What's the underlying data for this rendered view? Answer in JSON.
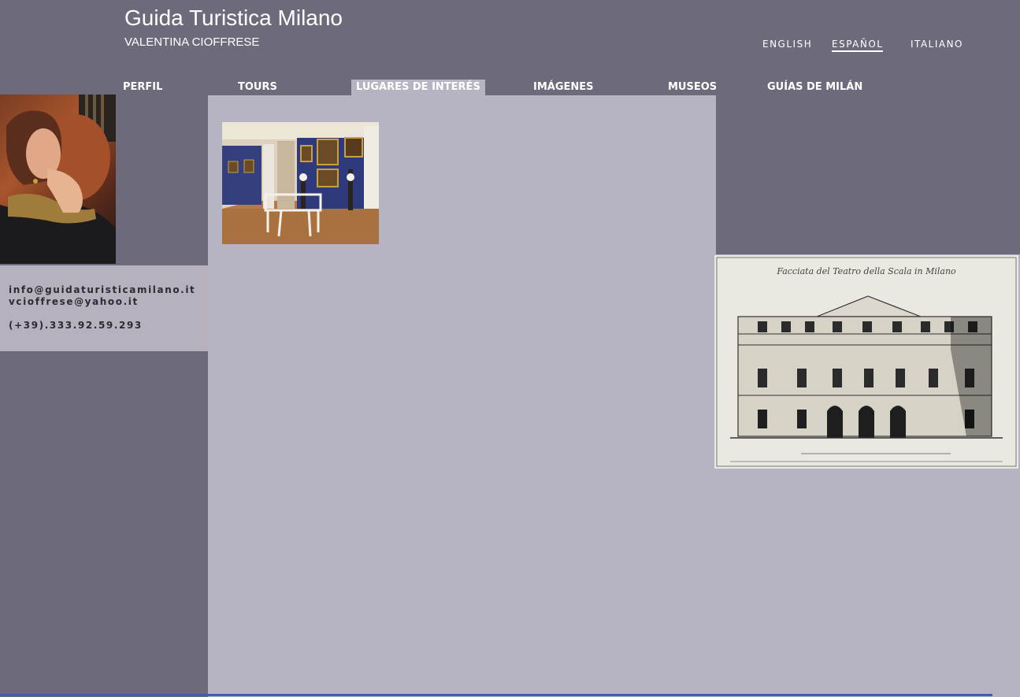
{
  "header": {
    "title": "Guida Turistica Milano",
    "subtitle": "VALENTINA CIOFFRESE"
  },
  "languages": [
    {
      "label": "ENGLISH",
      "active": false
    },
    {
      "label": "ESPAÑOL",
      "active": true
    },
    {
      "label": "ITALIANO",
      "active": false
    }
  ],
  "nav": [
    {
      "label": "PERFIL"
    },
    {
      "label": "TOURS"
    },
    {
      "label": "LUGARES DE INTERÉS",
      "active": true
    },
    {
      "label": "IMÁGENES"
    },
    {
      "label": "MUSEOS"
    },
    {
      "label": "GUÍAS DE MILÁN"
    }
  ],
  "contact": {
    "email1": "info@guidaturisticamilano.it",
    "email2": "vcioffrese@yahoo.it",
    "phone": "(+39).333.92.59.293"
  },
  "engraving": {
    "caption": "Facciata del Teatro della Scala in Milano"
  },
  "colors": {
    "background": "#6d6b7b",
    "panel": "#b6b4c2",
    "contact_panel": "#b7b0bd",
    "text_dark": "#2d2a33"
  }
}
